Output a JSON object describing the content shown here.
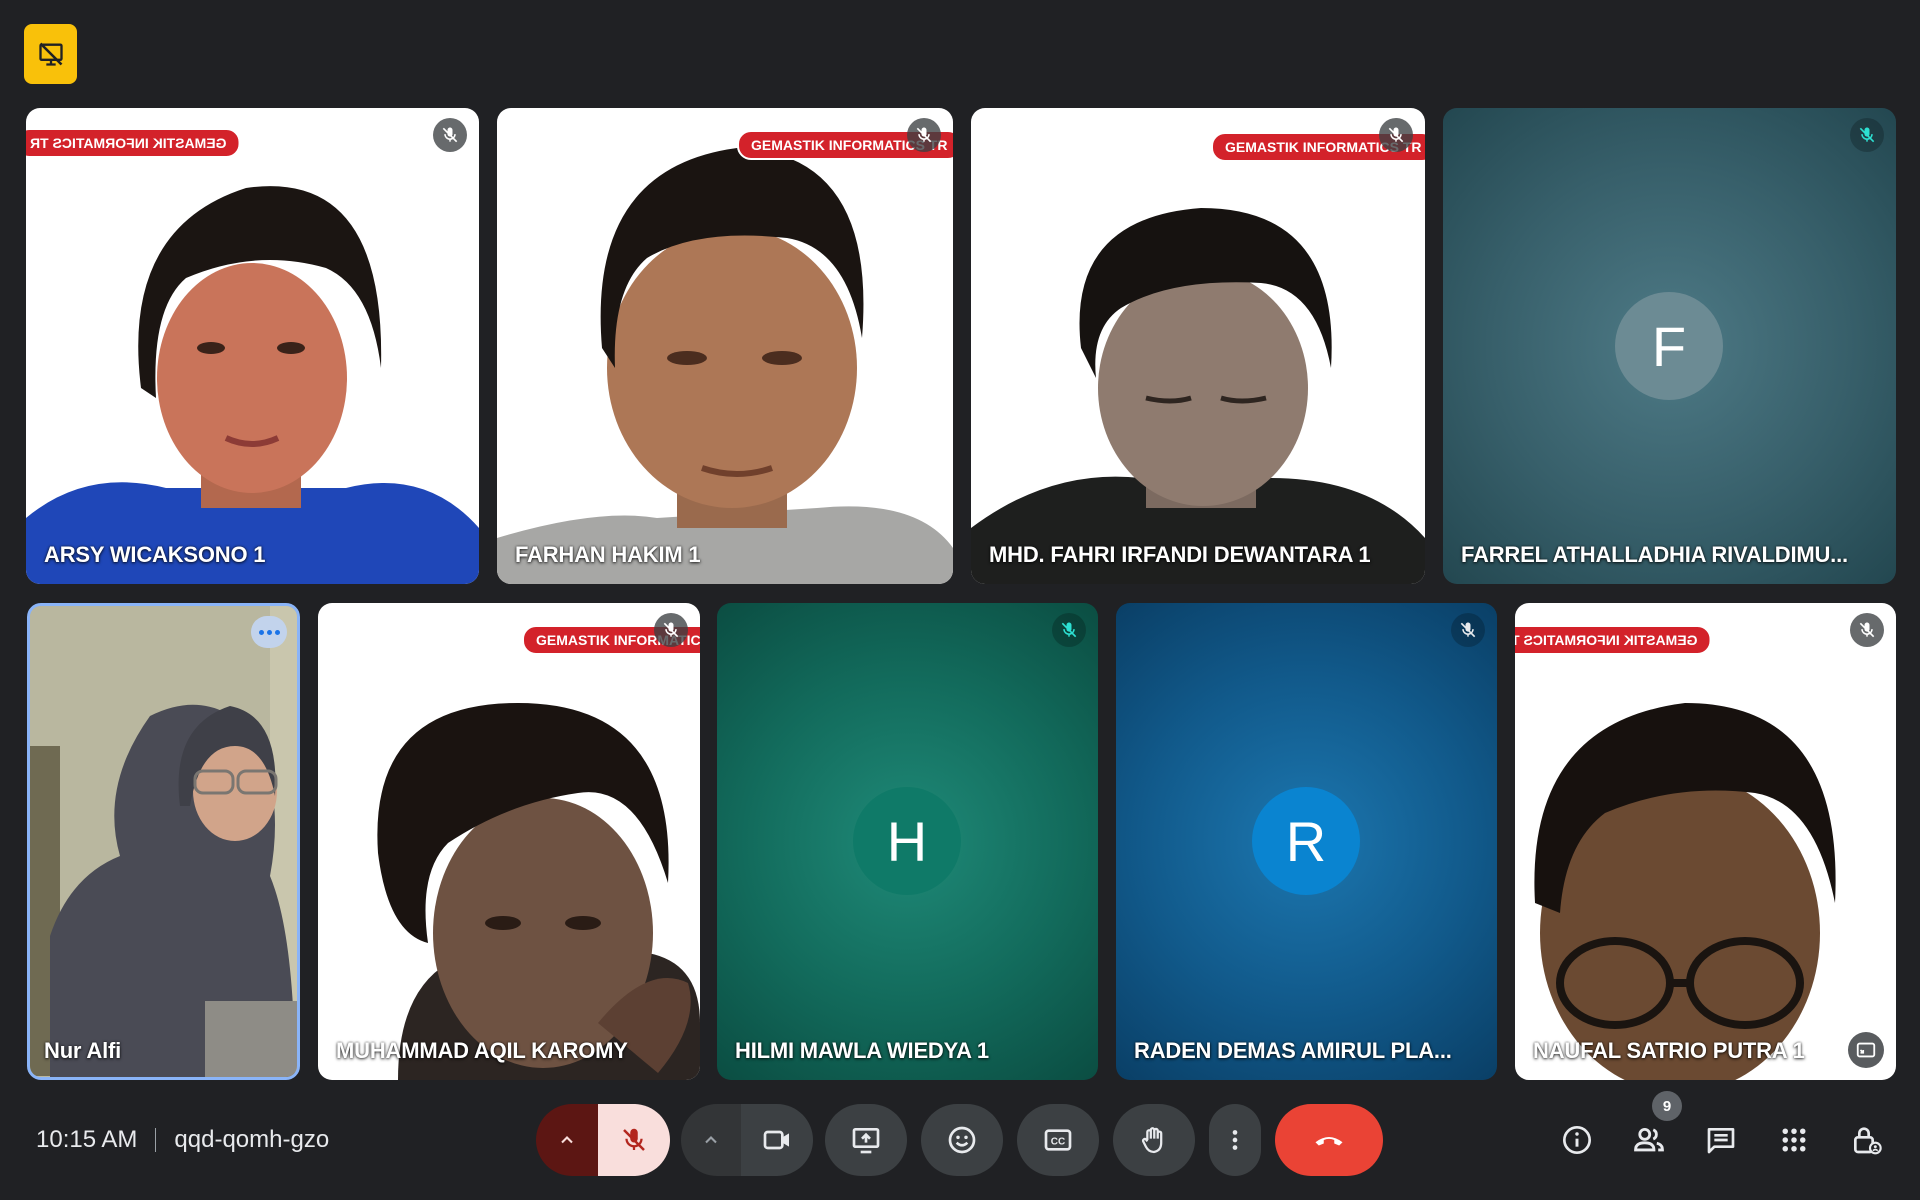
{
  "meeting": {
    "time": "10:15 AM",
    "code": "qqd-qomh-gzo",
    "participant_count": "9"
  },
  "top_badge": {
    "icon": "presentation-off-icon"
  },
  "banner_text": "GEMASTIK INFORMATICS TR",
  "participants": [
    {
      "name": "ARSY WICAKSONO 1",
      "video": true,
      "muted": true
    },
    {
      "name": "FARHAN HAKIM 1",
      "video": true,
      "muted": true
    },
    {
      "name": "MHD. FAHRI IRFANDI DEWANTARA 1",
      "video": true,
      "muted": true
    },
    {
      "name": "FARREL ATHALLADHIA RIVALDIMU...",
      "video": false,
      "initial": "F",
      "muted": true
    },
    {
      "name": "Nur Alfi",
      "video": true,
      "self": true
    },
    {
      "name": "MUHAMMAD AQIL KAROMY",
      "video": true,
      "muted": true
    },
    {
      "name": "HILMI MAWLA WIEDYA 1",
      "video": false,
      "initial": "H",
      "muted": true
    },
    {
      "name": "RADEN DEMAS AMIRUL PLA...",
      "video": false,
      "initial": "R",
      "muted": true
    },
    {
      "name": "NAUFAL SATRIO PUTRA 1",
      "video": true,
      "muted": true
    }
  ],
  "colors": {
    "background": "#202124",
    "self_border": "#8ab4f8",
    "end_call": "#ea4335",
    "mic_off_active": "#f9dedc",
    "banner_red": "#d3222a",
    "badge_yellow": "#f9c10a"
  },
  "controls": [
    {
      "name": "mic-options",
      "icon": "chevron-up-icon"
    },
    {
      "name": "microphone",
      "icon": "mic-off-icon",
      "state": "muted"
    },
    {
      "name": "camera-options",
      "icon": "chevron-up-icon"
    },
    {
      "name": "camera",
      "icon": "videocam-icon"
    },
    {
      "name": "present",
      "icon": "present-screen-icon"
    },
    {
      "name": "reactions",
      "icon": "emoji-icon"
    },
    {
      "name": "captions",
      "icon": "closed-captions-icon"
    },
    {
      "name": "raise-hand",
      "icon": "hand-icon"
    },
    {
      "name": "more-options",
      "icon": "more-vert-icon"
    },
    {
      "name": "leave-call",
      "icon": "call-end-icon"
    }
  ],
  "right_controls": [
    {
      "name": "meeting-details",
      "icon": "info-icon"
    },
    {
      "name": "people",
      "icon": "people-icon"
    },
    {
      "name": "chat",
      "icon": "chat-icon"
    },
    {
      "name": "activities",
      "icon": "apps-grid-icon"
    },
    {
      "name": "host-controls",
      "icon": "lock-person-icon"
    }
  ]
}
